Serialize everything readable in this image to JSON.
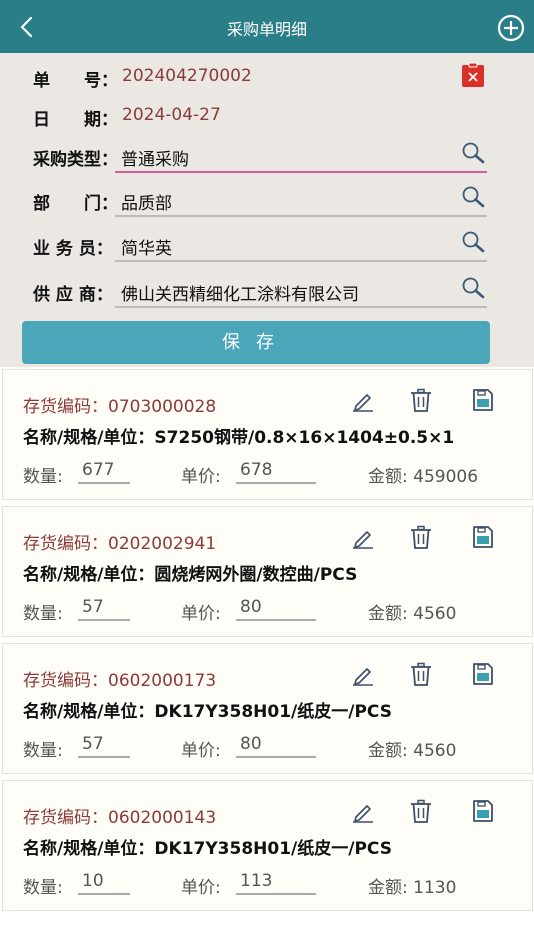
{
  "header": {
    "title": "采购单明细",
    "back_icon": "chevron-left-icon",
    "add_icon": "plus-circle-icon"
  },
  "form": {
    "order_no": {
      "label": "单　　号：",
      "value": "202404270002"
    },
    "date": {
      "label": "日　　期：",
      "value": "2024-04-27"
    },
    "purchase_type": {
      "label": "采购类型：",
      "value": "普通采购"
    },
    "department": {
      "label": "部　　门：",
      "value": "品质部"
    },
    "clerk": {
      "label": "业 务 员：",
      "value": "简华英"
    },
    "supplier": {
      "label": "供 应 商：",
      "value": "佛山关西精细化工涂料有限公司"
    },
    "save_label": "保存"
  },
  "labels": {
    "code": "存货编码：",
    "name": "名称/规格/单位：",
    "qty": "数量:",
    "price": "单价:",
    "amount": "金额:"
  },
  "items": [
    {
      "code": "0703000028",
      "name": "S7250钢带/0.8×16×1404±0.5×1",
      "qty": "677",
      "price": "678",
      "amount": "459006"
    },
    {
      "code": "0202002941",
      "name": "圆烧烤网外圈/数控曲/PCS",
      "qty": "57",
      "price": "80",
      "amount": "4560"
    },
    {
      "code": "0602000173",
      "name": "DK17Y358H01/纸皮一/PCS",
      "qty": "57",
      "price": "80",
      "amount": "4560"
    },
    {
      "code": "0602000143",
      "name": "DK17Y358H01/纸皮一/PCS",
      "qty": "10",
      "price": "113",
      "amount": "1130"
    }
  ],
  "colors": {
    "header": "#2a7e88",
    "save_button": "#4aa6b9",
    "accent_text": "#8b3a3a",
    "active_underline": "#d45fa0",
    "delete_red": "#d9302a"
  }
}
